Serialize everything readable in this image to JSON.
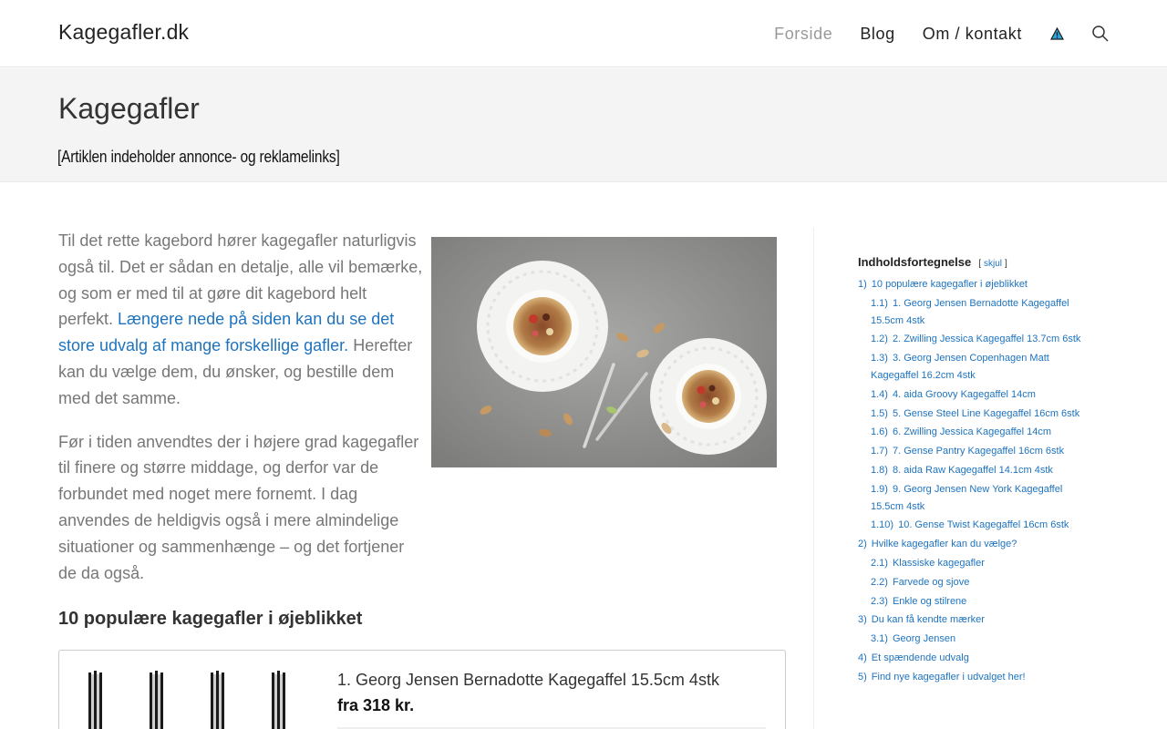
{
  "site": {
    "logo": "Kagegafler.dk",
    "nav": [
      {
        "label": "Forside",
        "active": true
      },
      {
        "label": "Blog",
        "active": false
      },
      {
        "label": "Om / kontakt",
        "active": false
      }
    ],
    "accent_color": "#1e73be"
  },
  "page": {
    "title": "Kagegafler",
    "disclaimer": "[Artiklen indeholder annonce- og reklamelinks]"
  },
  "content": {
    "p1_before": "Til det rette kagebord hører kagegafler naturligvis også til. Det er sådan en detalje, alle vil bemærke, og som er med til at gøre dit kagebord helt perfekt. ",
    "p1_link": "Længere nede på siden kan du se det store udvalg af mange forskellige gafler.",
    "p1_after": " Herefter kan du vælge dem, du ønsker, og bestille dem med det samme.",
    "p2": "Før i tiden anvendtes der i højere grad kagegafler til finere og større middage, og derfor var de forbundet med noget mere fornemt. I dag anvendes de heldigvis også i mere almindelige situationer og sammenhænge – og det fortjener de da også.",
    "section_heading": "10 populære kagegafler i øjeblikket",
    "product": {
      "name": "1. Georg Jensen Bernadotte Kagegaffel 15.5cm 4stk",
      "price": "fra 318 kr."
    }
  },
  "toc": {
    "title": "Indholdsfortegnelse",
    "toggle_open": "[",
    "toggle_label": "skjul",
    "toggle_close": "]",
    "items": [
      {
        "num": "1)",
        "label": "10 populære kagegafler i øjeblikket",
        "sub": false
      },
      {
        "num": "1.1)",
        "label": "1. Georg Jensen Bernadotte Kagegaffel 15.5cm 4stk",
        "sub": true
      },
      {
        "num": "1.2)",
        "label": "2. Zwilling Jessica Kagegaffel 13.7cm 6stk",
        "sub": true
      },
      {
        "num": "1.3)",
        "label": "3. Georg Jensen Copenhagen Matt Kagegaffel 16.2cm 4stk",
        "sub": true
      },
      {
        "num": "1.4)",
        "label": "4. aida Groovy Kagegaffel 14cm",
        "sub": true
      },
      {
        "num": "1.5)",
        "label": "5. Gense Steel Line Kagegaffel 16cm 6stk",
        "sub": true
      },
      {
        "num": "1.6)",
        "label": "6. Zwilling Jessica Kagegaffel 14cm",
        "sub": true
      },
      {
        "num": "1.7)",
        "label": "7. Gense Pantry Kagegaffel 16cm 6stk",
        "sub": true
      },
      {
        "num": "1.8)",
        "label": "8. aida Raw Kagegaffel 14.1cm 4stk",
        "sub": true
      },
      {
        "num": "1.9)",
        "label": "9. Georg Jensen New York Kagegaffel 15.5cm 4stk",
        "sub": true
      },
      {
        "num": "1.10)",
        "label": "10. Gense Twist Kagegaffel 16cm 6stk",
        "sub": true
      },
      {
        "num": "2)",
        "label": "Hvilke kagegafler kan du vælge?",
        "sub": false
      },
      {
        "num": "2.1)",
        "label": "Klassiske kagegafler",
        "sub": true
      },
      {
        "num": "2.2)",
        "label": "Farvede og sjove",
        "sub": true
      },
      {
        "num": "2.3)",
        "label": "Enkle og stilrene",
        "sub": true
      },
      {
        "num": "3)",
        "label": "Du kan få kendte mærker",
        "sub": false
      },
      {
        "num": "3.1)",
        "label": "Georg Jensen",
        "sub": true
      },
      {
        "num": "4)",
        "label": "Et spændende udvalg",
        "sub": false
      },
      {
        "num": "5)",
        "label": "Find nye kagegafler i udvalget her!",
        "sub": false
      }
    ]
  }
}
